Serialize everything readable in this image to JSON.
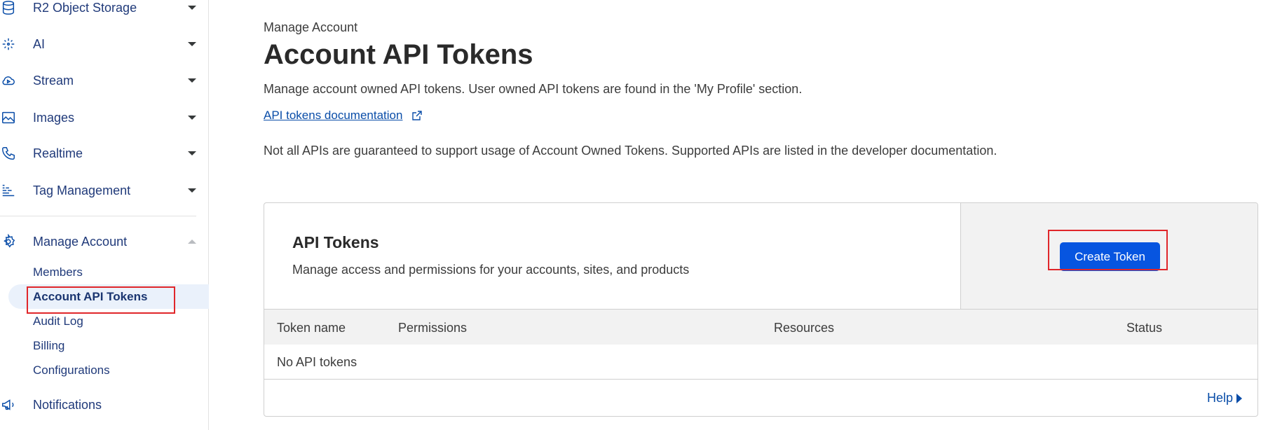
{
  "sidebar": {
    "items": [
      {
        "label": "R2 Object Storage",
        "icon": "database-icon"
      },
      {
        "label": "AI",
        "icon": "ai-sparkle-icon"
      },
      {
        "label": "Stream",
        "icon": "cloud-play-icon"
      },
      {
        "label": "Images",
        "icon": "image-icon"
      },
      {
        "label": "Realtime",
        "icon": "phone-icon"
      },
      {
        "label": "Tag Management",
        "icon": "tag-list-icon"
      }
    ],
    "manage_account": {
      "label": "Manage Account",
      "icon": "gear-icon",
      "subitems": [
        "Members",
        "Account API Tokens",
        "Audit Log",
        "Billing",
        "Configurations"
      ],
      "active": "Account API Tokens"
    },
    "notifications": {
      "label": "Notifications",
      "icon": "megaphone-icon"
    }
  },
  "main": {
    "breadcrumb": "Manage Account",
    "title": "Account API Tokens",
    "description": "Manage account owned API tokens. User owned API tokens are found in the 'My Profile' section.",
    "doc_link": "API tokens documentation",
    "note": "Not all APIs are guaranteed to support usage of Account Owned Tokens. Supported APIs are listed in the developer documentation."
  },
  "card": {
    "title": "API Tokens",
    "subtitle": "Manage access and permissions for your accounts, sites, and products",
    "create_button": "Create Token",
    "columns": [
      "Token name",
      "Permissions",
      "Resources",
      "Status"
    ],
    "empty_text": "No API tokens",
    "help_link": "Help"
  },
  "colors": {
    "accent": "#0755e0",
    "link": "#0a4da8",
    "highlight": "#e0262a",
    "active_bg": "#eaf1fb"
  }
}
